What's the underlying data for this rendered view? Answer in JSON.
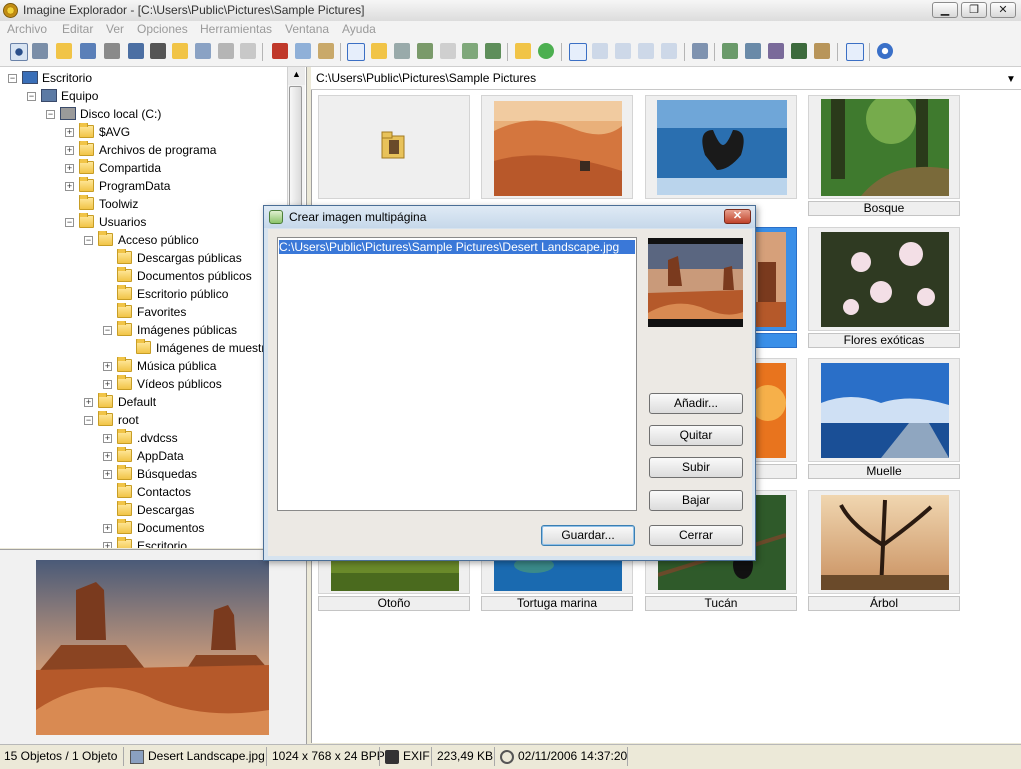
{
  "window": {
    "title": "Imagine Explorador - [C:\\Users\\Public\\Pictures\\Sample Pictures]",
    "min": "▁",
    "max": "❐",
    "close": "✕"
  },
  "menu": [
    "Archivo",
    "Editar",
    "Ver",
    "Opciones",
    "Herramientas",
    "Ventana",
    "Ayuda"
  ],
  "tree": [
    {
      "label": "Escritorio",
      "level": 0,
      "icon": "desktop-icon",
      "exp": "−"
    },
    {
      "label": "Equipo",
      "level": 1,
      "icon": "computer-icon",
      "exp": "−"
    },
    {
      "label": "Disco local (C:)",
      "level": 2,
      "icon": "drive-icon",
      "exp": "−"
    },
    {
      "label": "$AVG",
      "level": 3,
      "icon": "folder-icon",
      "exp": "+"
    },
    {
      "label": "Archivos de programa",
      "level": 3,
      "icon": "folder-icon",
      "exp": "+"
    },
    {
      "label": "Compartida",
      "level": 3,
      "icon": "folder-icon",
      "exp": "+"
    },
    {
      "label": "ProgramData",
      "level": 3,
      "icon": "folder-icon",
      "exp": "+"
    },
    {
      "label": "Toolwiz",
      "level": 3,
      "icon": "folder-icon",
      "exp": ""
    },
    {
      "label": "Usuarios",
      "level": 3,
      "icon": "folder-icon",
      "exp": "−"
    },
    {
      "label": "Acceso público",
      "level": 4,
      "icon": "folder-icon",
      "exp": "−"
    },
    {
      "label": "Descargas públicas",
      "level": 5,
      "icon": "folder-icon",
      "exp": ""
    },
    {
      "label": "Documentos públicos",
      "level": 5,
      "icon": "folder-icon",
      "exp": ""
    },
    {
      "label": "Escritorio público",
      "level": 5,
      "icon": "folder-icon",
      "exp": ""
    },
    {
      "label": "Favorites",
      "level": 5,
      "icon": "folder-icon",
      "exp": ""
    },
    {
      "label": "Imágenes públicas",
      "level": 5,
      "icon": "folder-icon",
      "exp": "−"
    },
    {
      "label": "Imágenes de muestr",
      "level": 6,
      "icon": "folder-icon",
      "exp": ""
    },
    {
      "label": "Música pública",
      "level": 5,
      "icon": "folder-icon",
      "exp": "+"
    },
    {
      "label": "Vídeos públicos",
      "level": 5,
      "icon": "folder-icon",
      "exp": "+"
    },
    {
      "label": "Default",
      "level": 4,
      "icon": "folder-icon",
      "exp": "+"
    },
    {
      "label": "root",
      "level": 4,
      "icon": "folder-icon",
      "exp": "−"
    },
    {
      "label": ".dvdcss",
      "level": 5,
      "icon": "folder-icon",
      "exp": "+"
    },
    {
      "label": "AppData",
      "level": 5,
      "icon": "folder-icon",
      "exp": "+"
    },
    {
      "label": "Búsquedas",
      "level": 5,
      "icon": "folder-icon",
      "exp": "+"
    },
    {
      "label": "Contactos",
      "level": 5,
      "icon": "folder-icon",
      "exp": ""
    },
    {
      "label": "Descargas",
      "level": 5,
      "icon": "folder-icon",
      "exp": ""
    },
    {
      "label": "Documentos",
      "level": 5,
      "icon": "folder-icon",
      "exp": "+"
    },
    {
      "label": "Escritorio",
      "level": 5,
      "icon": "folder-icon",
      "exp": "+"
    }
  ],
  "path": "C:\\Users\\Public\\Pictures\\Sample Pictures",
  "path_dropdown": "▼",
  "thumbnails": [
    {
      "label": "",
      "kind": "folder"
    },
    {
      "label": "",
      "kind": "desert"
    },
    {
      "label": "",
      "kind": "whale"
    },
    {
      "label": "Bosque",
      "kind": "forest"
    },
    {
      "label": "Flores exóticas",
      "kind": "flowers"
    },
    {
      "label": "Muelle",
      "kind": "pier"
    },
    {
      "label": "Otoño",
      "kind": "autumn"
    },
    {
      "label": "Tortuga marina",
      "kind": "turtle"
    },
    {
      "label": "Tucán",
      "kind": "toucan"
    },
    {
      "label": "Árbol",
      "kind": "tree"
    }
  ],
  "dialog": {
    "title": "Crear imagen multipágina",
    "close": "✕",
    "files": [
      "C:\\Users\\Public\\Pictures\\Sample Pictures\\Desert Landscape.jpg"
    ],
    "buttons": {
      "add": "Añadir...",
      "remove": "Quitar",
      "up": "Subir",
      "down": "Bajar",
      "save": "Guardar...",
      "close": "Cerrar"
    }
  },
  "status": {
    "objects": "15 Objetos / 1 Objeto",
    "filename": "Desert Landscape.jpg",
    "dimensions": "1024 x 768 x 24 BPP",
    "exif": "EXIF",
    "size": "223,49 KB",
    "date": "02/11/2006 14:37:20"
  },
  "colors": {
    "selection": "#3a78d8",
    "dialog_frame": "#4a6e96",
    "close_button": "#c0432b"
  }
}
